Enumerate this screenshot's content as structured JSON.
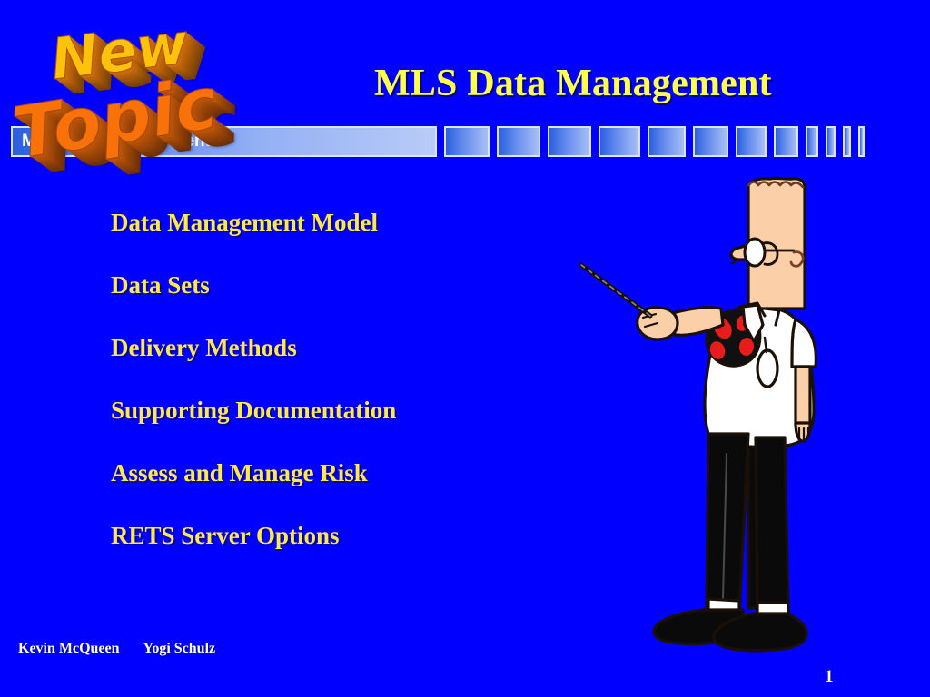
{
  "slide": {
    "background_color": "#0000FF",
    "title": "MLS Data Management",
    "title_color": "#FFFF4D"
  },
  "wordart": {
    "line1": "New",
    "line2": "Topic",
    "line1_color": "#FFC20A",
    "line2_color": "#F97209",
    "extrusion_color": "#A8560A"
  },
  "banner": {
    "label": "MLS Data Management",
    "gradient_start": "#2B5FE0",
    "gradient_end": "#B9CBF8",
    "border_color": "#DBE4FB",
    "block_count": 12
  },
  "body": {
    "bullets": [
      "Data Management Model",
      "Data Sets",
      "Delivery Methods",
      "Supporting Documentation",
      "Assess and Manage Risk",
      "RETS Server Options"
    ],
    "text_color": "#FFE94D"
  },
  "footer": {
    "author_1": "Kevin McQueen",
    "author_2": "Yogi Schulz",
    "page_number": "1",
    "text_color": "#FFFFFF"
  },
  "illustration": {
    "name": "dilbert-pointing-character",
    "skin_color": "#FBCFA8",
    "shirt_color": "#FFFFFF",
    "pants_color": "#0A0A0A",
    "tie_color": "#101010",
    "tie_accent_color": "#E81C1C",
    "outline_color": "#1A1008"
  }
}
